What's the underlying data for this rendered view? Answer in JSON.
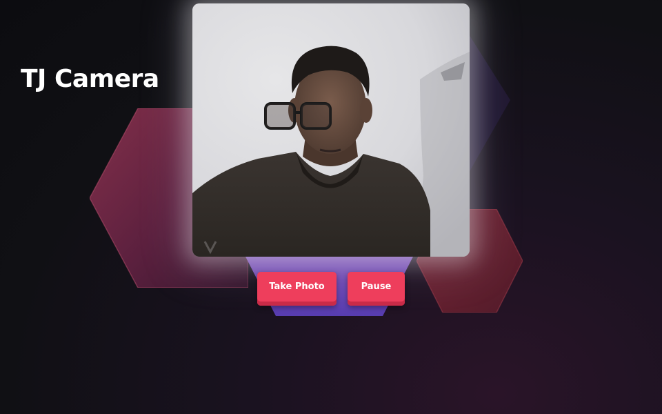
{
  "app": {
    "title": "TJ Camera"
  },
  "camera": {
    "label": "camera-video-preview"
  },
  "controls": {
    "take_photo_label": "Take Photo",
    "pause_label": "Pause"
  },
  "colors": {
    "button_bg": "#ee3e5c",
    "button_shadow": "#c92b48",
    "background": "#101014",
    "trapezoid_accent": "#6a4bc4"
  }
}
